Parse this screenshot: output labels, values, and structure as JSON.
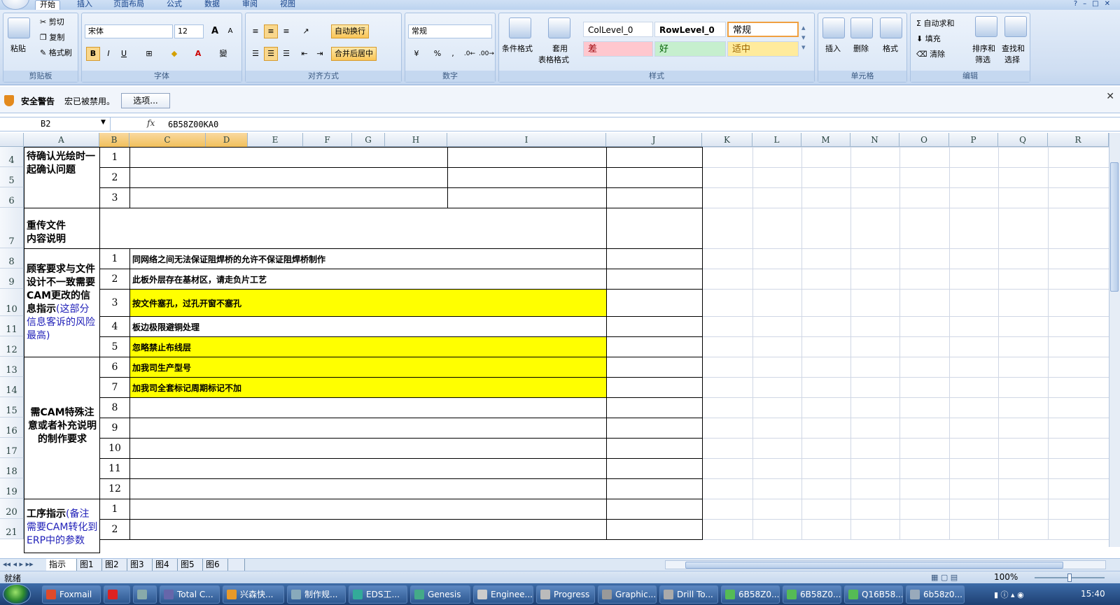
{
  "ribbon": {
    "tabs": [
      "开始",
      "插入",
      "页面布局",
      "公式",
      "数据",
      "审阅",
      "视图"
    ],
    "clipboard": {
      "paste": "粘贴",
      "cut": "剪切",
      "copy": "复制",
      "format_painter": "格式刷",
      "label": "剪贴板"
    },
    "font": {
      "name": "宋体",
      "size": "12",
      "bold": "B",
      "italic": "I",
      "underline": "U",
      "grow": "A",
      "shrink": "A",
      "font_color": "A",
      "wen": "變",
      "label": "字体"
    },
    "alignment": {
      "wrap": "自动换行",
      "merge": "合并后居中",
      "label": "对齐方式"
    },
    "number": {
      "format": "常规",
      "percent": "%",
      "comma": ",",
      "label": "数字"
    },
    "styles": {
      "cond_format": "条件格式",
      "table_format_1": "套用",
      "table_format_2": "表格格式",
      "label": "样式",
      "cells": [
        "ColLevel_0",
        "RowLevel_0",
        "常规",
        "差",
        "好",
        "适中"
      ]
    },
    "cells_group": {
      "insert": "插入",
      "delete": "删除",
      "format": "格式",
      "label": "单元格"
    },
    "editing": {
      "autosum": "自动求和",
      "fill": "填充",
      "clear": "清除",
      "sort_1": "排序和",
      "sort_2": "筛选",
      "find_1": "查找和",
      "find_2": "选择",
      "label": "编辑"
    }
  },
  "security": {
    "title": "安全警告",
    "message": "宏已被禁用。",
    "options_button": "选项..."
  },
  "formula_bar": {
    "name_box": "B2",
    "fx": "fx",
    "content": "6B58Z00KA0"
  },
  "columns": [
    "A",
    "B",
    "C",
    "D",
    "E",
    "F",
    "G",
    "H",
    "I",
    "J",
    "K",
    "L",
    "M",
    "N",
    "O",
    "P",
    "Q",
    "R"
  ],
  "rows": [
    "4",
    "5",
    "6",
    "7",
    "8",
    "9",
    "10",
    "11",
    "12",
    "13",
    "14",
    "15",
    "16",
    "17",
    "18",
    "19",
    "20",
    "21"
  ],
  "sheet": {
    "label_confirm": "待确认光绘时一起确认问题",
    "label_reupload_1": "重传文件",
    "label_reupload_2": "内容说明",
    "label_customer_bold": "顾客要求与文件设计不一致需要CAM更改的信息指示",
    "label_customer_blue": "(这部分信息客诉的风险最高)",
    "label_special": "需CAM特殊注意或者补充说明的制作要求",
    "label_process_bold": "工序指示",
    "label_process_blue": "(备注需要CAM转化到ERP中的参数",
    "confirm_nums": [
      "1",
      "2",
      "3"
    ],
    "customer_items": [
      {
        "n": "1",
        "text": "同网络之间无法保证阻焊桥的允许不保证阻焊桥制作"
      },
      {
        "n": "2",
        "text": "此板外层存在基材区，请走负片工艺"
      },
      {
        "n": "3",
        "text": "按文件塞孔，过孔开窗不塞孔"
      },
      {
        "n": "4",
        "text": "板边极限避铜处理"
      },
      {
        "n": "5",
        "text": "忽略禁止布线层"
      }
    ],
    "special_items": [
      {
        "n": "6",
        "text": "加我司生产型号"
      },
      {
        "n": "7",
        "text": "加我司全套标记周期标记不加"
      },
      {
        "n": "8",
        "text": ""
      },
      {
        "n": "9",
        "text": ""
      },
      {
        "n": "10",
        "text": ""
      },
      {
        "n": "11",
        "text": ""
      },
      {
        "n": "12",
        "text": ""
      }
    ],
    "process_nums": [
      "1",
      "2"
    ],
    "highlight_color": "#ffff00"
  },
  "sheet_tabs": [
    "指示",
    "图1",
    "图2",
    "图3",
    "图4",
    "图5",
    "图6"
  ],
  "status": {
    "ready": "就绪",
    "zoom": "100%"
  },
  "taskbar": {
    "items": [
      "Foxmail",
      "",
      "",
      "Total C...",
      "兴森快...",
      "制作规...",
      "EDS工...",
      "Genesis",
      "Enginee...",
      "Progress",
      "Graphic...",
      "Drill To...",
      "6B58Z0...",
      "6B58Z0...",
      "Q16B58...",
      "6b58z0..."
    ],
    "clock": "15:40"
  }
}
